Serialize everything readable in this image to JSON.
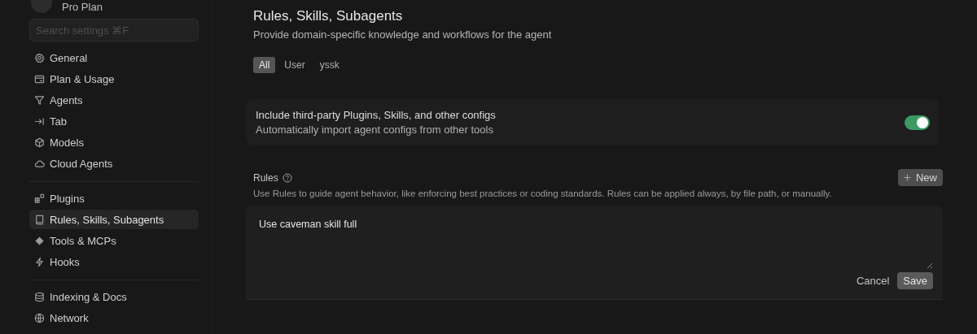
{
  "account": {
    "plan": "Pro Plan"
  },
  "search": {
    "placeholder": "Search settings ⌘F"
  },
  "sidebar": {
    "groups": [
      {
        "items": [
          {
            "label": "General",
            "selected": false
          },
          {
            "label": "Plan & Usage",
            "selected": false
          },
          {
            "label": "Agents",
            "selected": false
          },
          {
            "label": "Tab",
            "selected": false
          },
          {
            "label": "Models",
            "selected": false
          },
          {
            "label": "Cloud Agents",
            "selected": false
          }
        ]
      },
      {
        "items": [
          {
            "label": "Plugins",
            "selected": false
          },
          {
            "label": "Rules, Skills, Subagents",
            "selected": true
          },
          {
            "label": "Tools & MCPs",
            "selected": false
          },
          {
            "label": "Hooks",
            "selected": false
          }
        ]
      },
      {
        "items": [
          {
            "label": "Indexing & Docs",
            "selected": false
          },
          {
            "label": "Network",
            "selected": false
          }
        ]
      }
    ]
  },
  "page": {
    "title": "Rules, Skills, Subagents",
    "subtitle": "Provide domain-specific knowledge and workflows for the agent"
  },
  "filters": [
    {
      "label": "All",
      "selected": true
    },
    {
      "label": "User",
      "selected": false
    },
    {
      "label": "yssk",
      "selected": false
    }
  ],
  "setting": {
    "title": "Include third-party Plugins, Skills, and other configs",
    "description": "Automatically import agent configs from other tools",
    "on": true
  },
  "rules": {
    "title": "Rules",
    "new_button": "New",
    "description": "Use Rules to guide agent behavior, like enforcing best practices or coding standards. Rules can be applied always, by file path, or manually.",
    "editor": {
      "value": "Use caveman skill full",
      "cancel": "Cancel",
      "save": "Save"
    }
  }
}
